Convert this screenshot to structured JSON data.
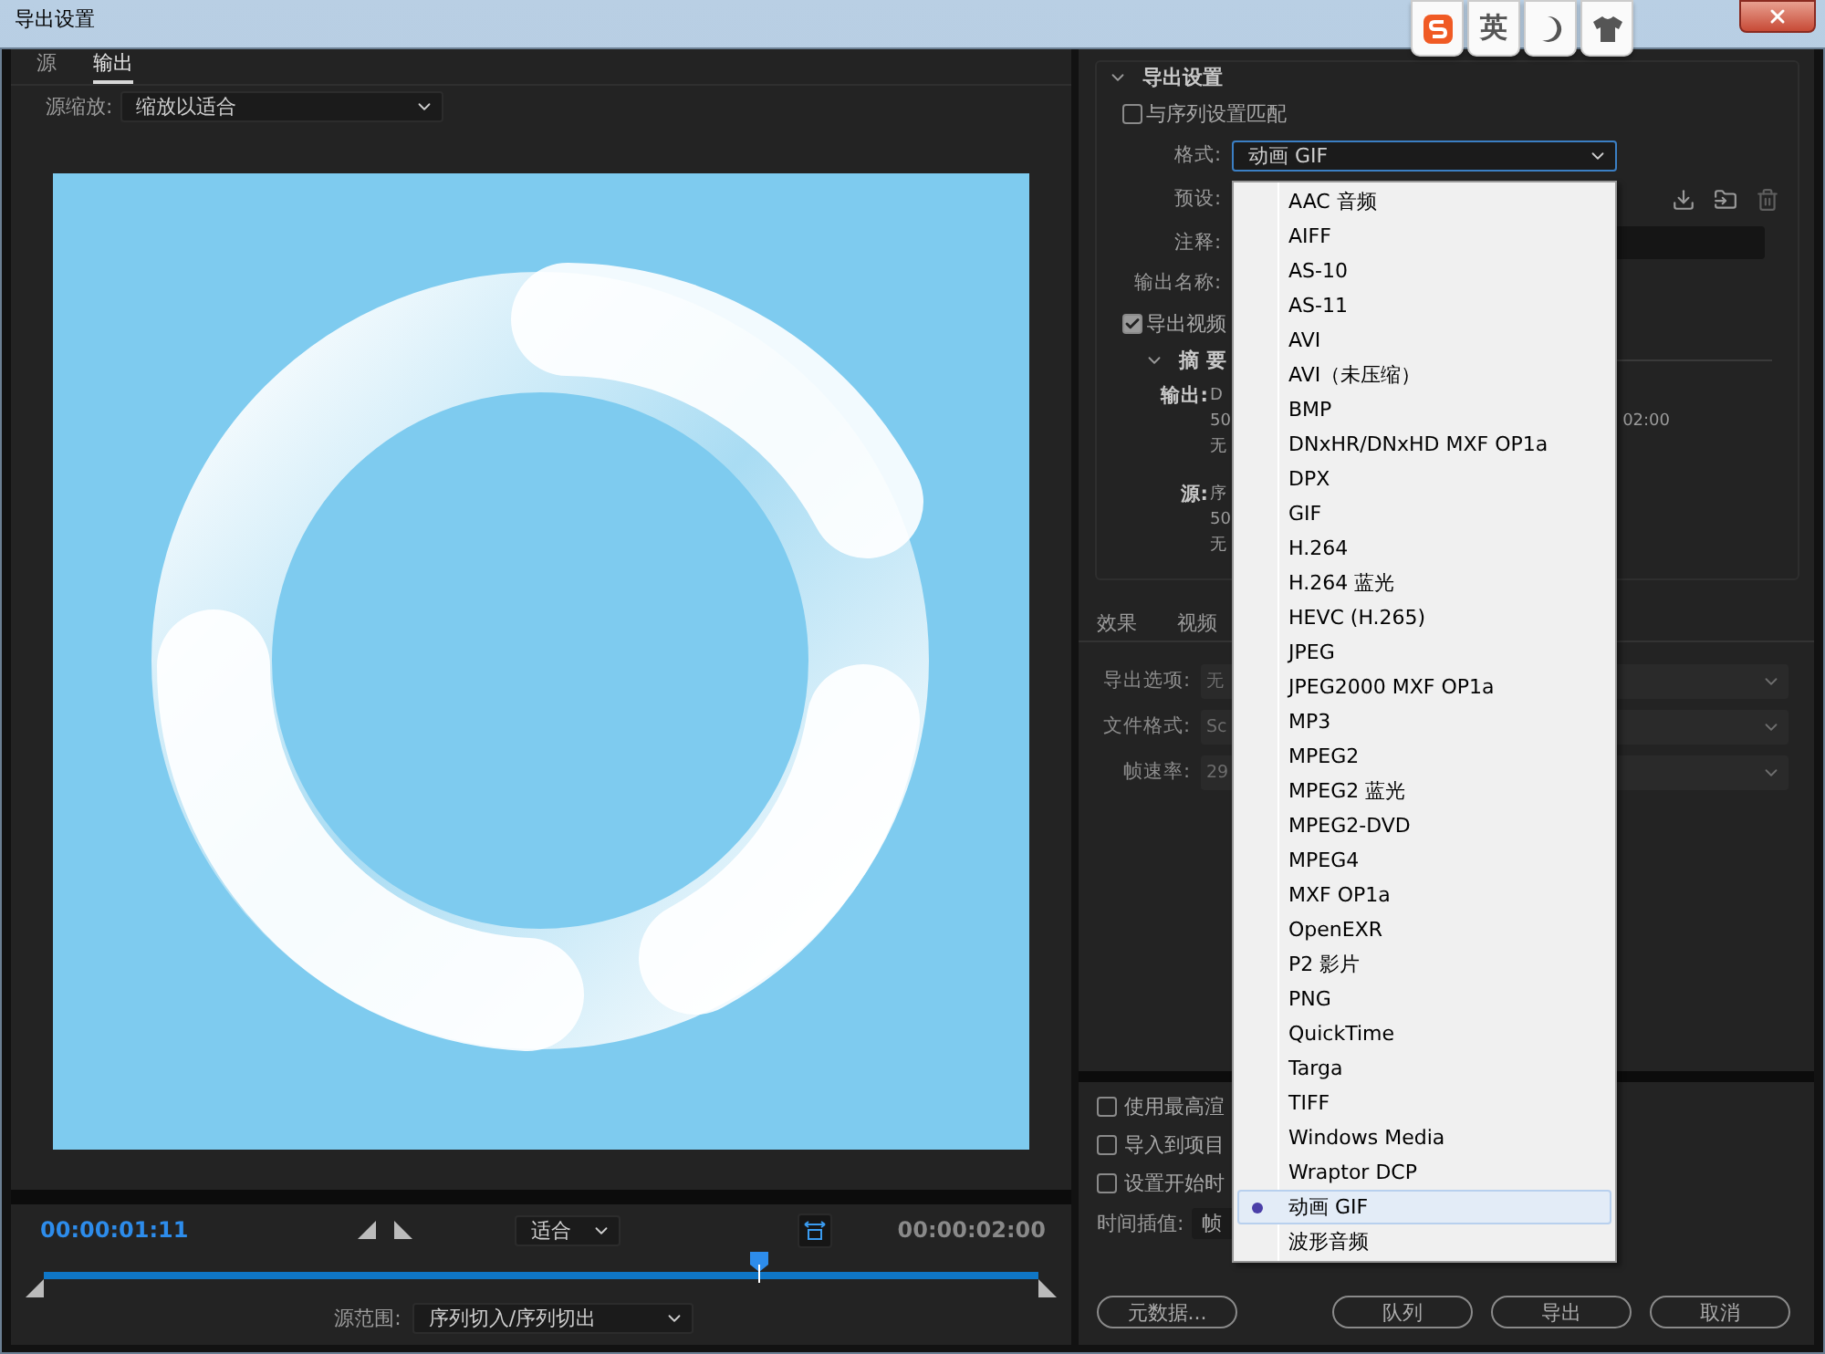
{
  "window": {
    "title": "导出设置"
  },
  "ime_toolbar": {
    "language": "英"
  },
  "left_tabs": [
    {
      "label": "源",
      "selected": false
    },
    {
      "label": "输出",
      "selected": true
    }
  ],
  "source_scale": {
    "label": "源缩放:",
    "value": "缩放以适合"
  },
  "timeline": {
    "current": "00:00:01:11",
    "fit": "适合",
    "duration": "00:00:02:00",
    "level": 0.72,
    "range_label": "源范围:",
    "range_value": "序列切入/序列切出"
  },
  "export_settings": {
    "title": "导出设置",
    "expanded": true,
    "match_sequence": {
      "label": "与序列设置匹配",
      "checked": false
    },
    "format": {
      "label": "格式:",
      "value": "动画 GIF",
      "open": true
    },
    "preset_label": "预设:",
    "comment_label": "注释:",
    "output_name_label": "输出名称:",
    "export_video": {
      "label": "导出视频",
      "checked": true
    },
    "summary": {
      "title": "摘 要",
      "expanded": true,
      "output_label": "输出:",
      "output_lines": [
        "D",
        "50",
        "无"
      ],
      "output_extra": "02:00",
      "source_label": "源:",
      "source_lines": [
        "序",
        "50",
        "无"
      ]
    }
  },
  "settings_tabs": [
    {
      "label": "效果",
      "selected": false
    },
    {
      "label": "视频",
      "selected": false
    }
  ],
  "options": [
    {
      "label": "导出选项:",
      "value": "无"
    },
    {
      "label": "文件格式:",
      "value": "Sc"
    },
    {
      "label": "帧速率:",
      "value": "29"
    }
  ],
  "render_options": [
    {
      "label": "使用最高渲",
      "checked": false
    },
    {
      "label": "导入到项目",
      "checked": false
    },
    {
      "label": "设置开始时",
      "checked": false
    }
  ],
  "interpolation": {
    "label": "时间插值:",
    "value": "帧"
  },
  "buttons": [
    "元数据...",
    "队列",
    "导出",
    "取消"
  ],
  "format_menu": [
    {
      "label": "AAC 音频",
      "selected": false
    },
    {
      "label": "AIFF",
      "selected": false
    },
    {
      "label": "AS-10",
      "selected": false
    },
    {
      "label": "AS-11",
      "selected": false
    },
    {
      "label": "AVI",
      "selected": false
    },
    {
      "label": "AVI（未压缩）",
      "selected": false
    },
    {
      "label": "BMP",
      "selected": false
    },
    {
      "label": "DNxHR/DNxHD MXF OP1a",
      "selected": false
    },
    {
      "label": "DPX",
      "selected": false
    },
    {
      "label": "GIF",
      "selected": false
    },
    {
      "label": "H.264",
      "selected": false
    },
    {
      "label": "H.264 蓝光",
      "selected": false
    },
    {
      "label": "HEVC (H.265)",
      "selected": false
    },
    {
      "label": "JPEG",
      "selected": false
    },
    {
      "label": "JPEG2000 MXF OP1a",
      "selected": false
    },
    {
      "label": "MP3",
      "selected": false
    },
    {
      "label": "MPEG2",
      "selected": false
    },
    {
      "label": "MPEG2 蓝光",
      "selected": false
    },
    {
      "label": "MPEG2-DVD",
      "selected": false
    },
    {
      "label": "MPEG4",
      "selected": false
    },
    {
      "label": "MXF OP1a",
      "selected": false
    },
    {
      "label": "OpenEXR",
      "selected": false
    },
    {
      "label": "P2 影片",
      "selected": false
    },
    {
      "label": "PNG",
      "selected": false
    },
    {
      "label": "QuickTime",
      "selected": false
    },
    {
      "label": "Targa",
      "selected": false
    },
    {
      "label": "TIFF",
      "selected": false
    },
    {
      "label": "Windows Media",
      "selected": false
    },
    {
      "label": "Wraptor DCP",
      "selected": false
    },
    {
      "label": "动画 GIF",
      "selected": true
    },
    {
      "label": "波形音频",
      "selected": false
    }
  ]
}
